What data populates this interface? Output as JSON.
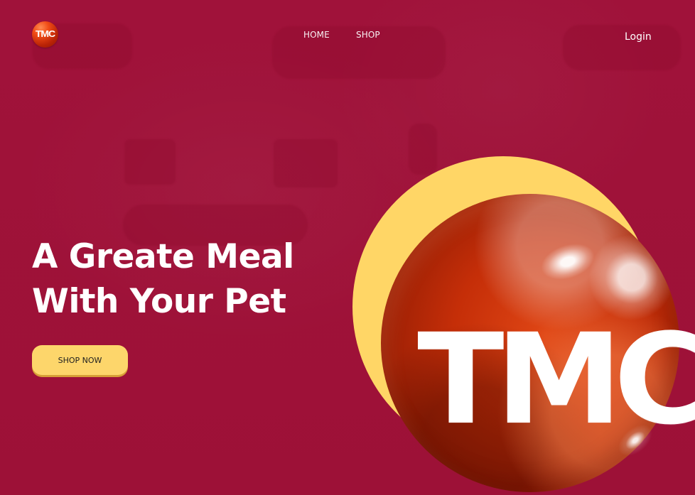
{
  "nav": {
    "brand_logo_text": "TMC",
    "home_label": "HOME",
    "shop_label": "SHOP",
    "login_label": "Login"
  },
  "hero": {
    "headline_line_1": "A Greate Meal",
    "headline_line_2": "With Your Pet",
    "cta_label": "SHOP NOW",
    "feature_logo_text": "TMC"
  },
  "colors": {
    "background": "#9e1238",
    "accent": "#fdd66b",
    "logo_orange": "#d9420f",
    "text": "#ffffff"
  },
  "icons": {
    "brand_logo": "tmc-logo-icon",
    "hero_logo": "tmc-sphere-icon"
  }
}
